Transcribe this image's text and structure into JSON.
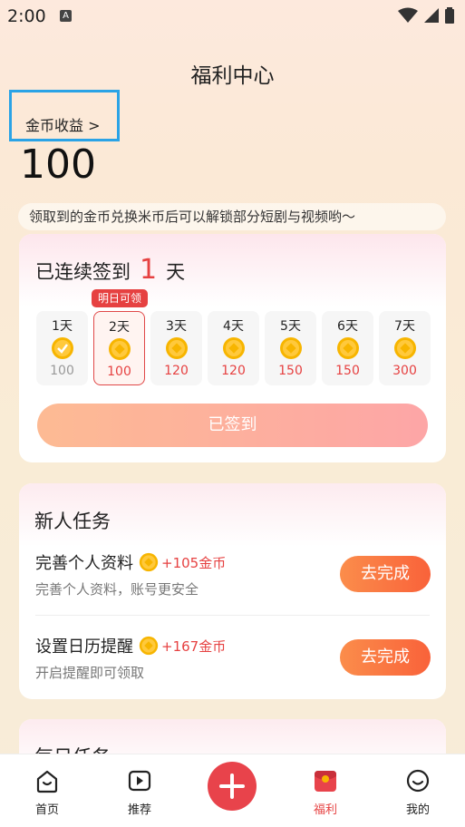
{
  "status_bar": {
    "time": "2:00",
    "notification_glyph": "A"
  },
  "header": {
    "title": "福利中心"
  },
  "coins": {
    "income_label": "金币收益 >",
    "balance": "100"
  },
  "notice": "领取到的金币兑换米币后可以解锁部分短剧与视频哟～",
  "signin": {
    "prefix": "已连续签到",
    "days_count": "1",
    "suffix": "天",
    "tomorrow_badge": "明日可领",
    "days": [
      {
        "label": "1天",
        "value": "100",
        "state": "claimed"
      },
      {
        "label": "2天",
        "value": "100",
        "state": "active"
      },
      {
        "label": "3天",
        "value": "120",
        "state": "pending"
      },
      {
        "label": "4天",
        "value": "120",
        "state": "pending"
      },
      {
        "label": "5天",
        "value": "150",
        "state": "pending"
      },
      {
        "label": "6天",
        "value": "150",
        "state": "pending"
      },
      {
        "label": "7天",
        "value": "300",
        "state": "pending"
      }
    ],
    "button_label": "已签到"
  },
  "new_tasks": {
    "title": "新人任务",
    "items": [
      {
        "title": "完善个人资料",
        "reward": "+105金币",
        "subtitle": "完善个人资料，账号更安全",
        "button": "去完成"
      },
      {
        "title": "设置日历提醒",
        "reward": "+167金币",
        "subtitle": "开启提醒即可领取",
        "button": "去完成"
      }
    ]
  },
  "daily_tasks": {
    "title": "每日任务"
  },
  "nav": {
    "home": "首页",
    "recommend": "推荐",
    "welfare": "福利",
    "mine": "我的"
  },
  "colors": {
    "accent": "#e64141",
    "coin": "#f7b500",
    "highlight_box": "#2aa3e6"
  }
}
